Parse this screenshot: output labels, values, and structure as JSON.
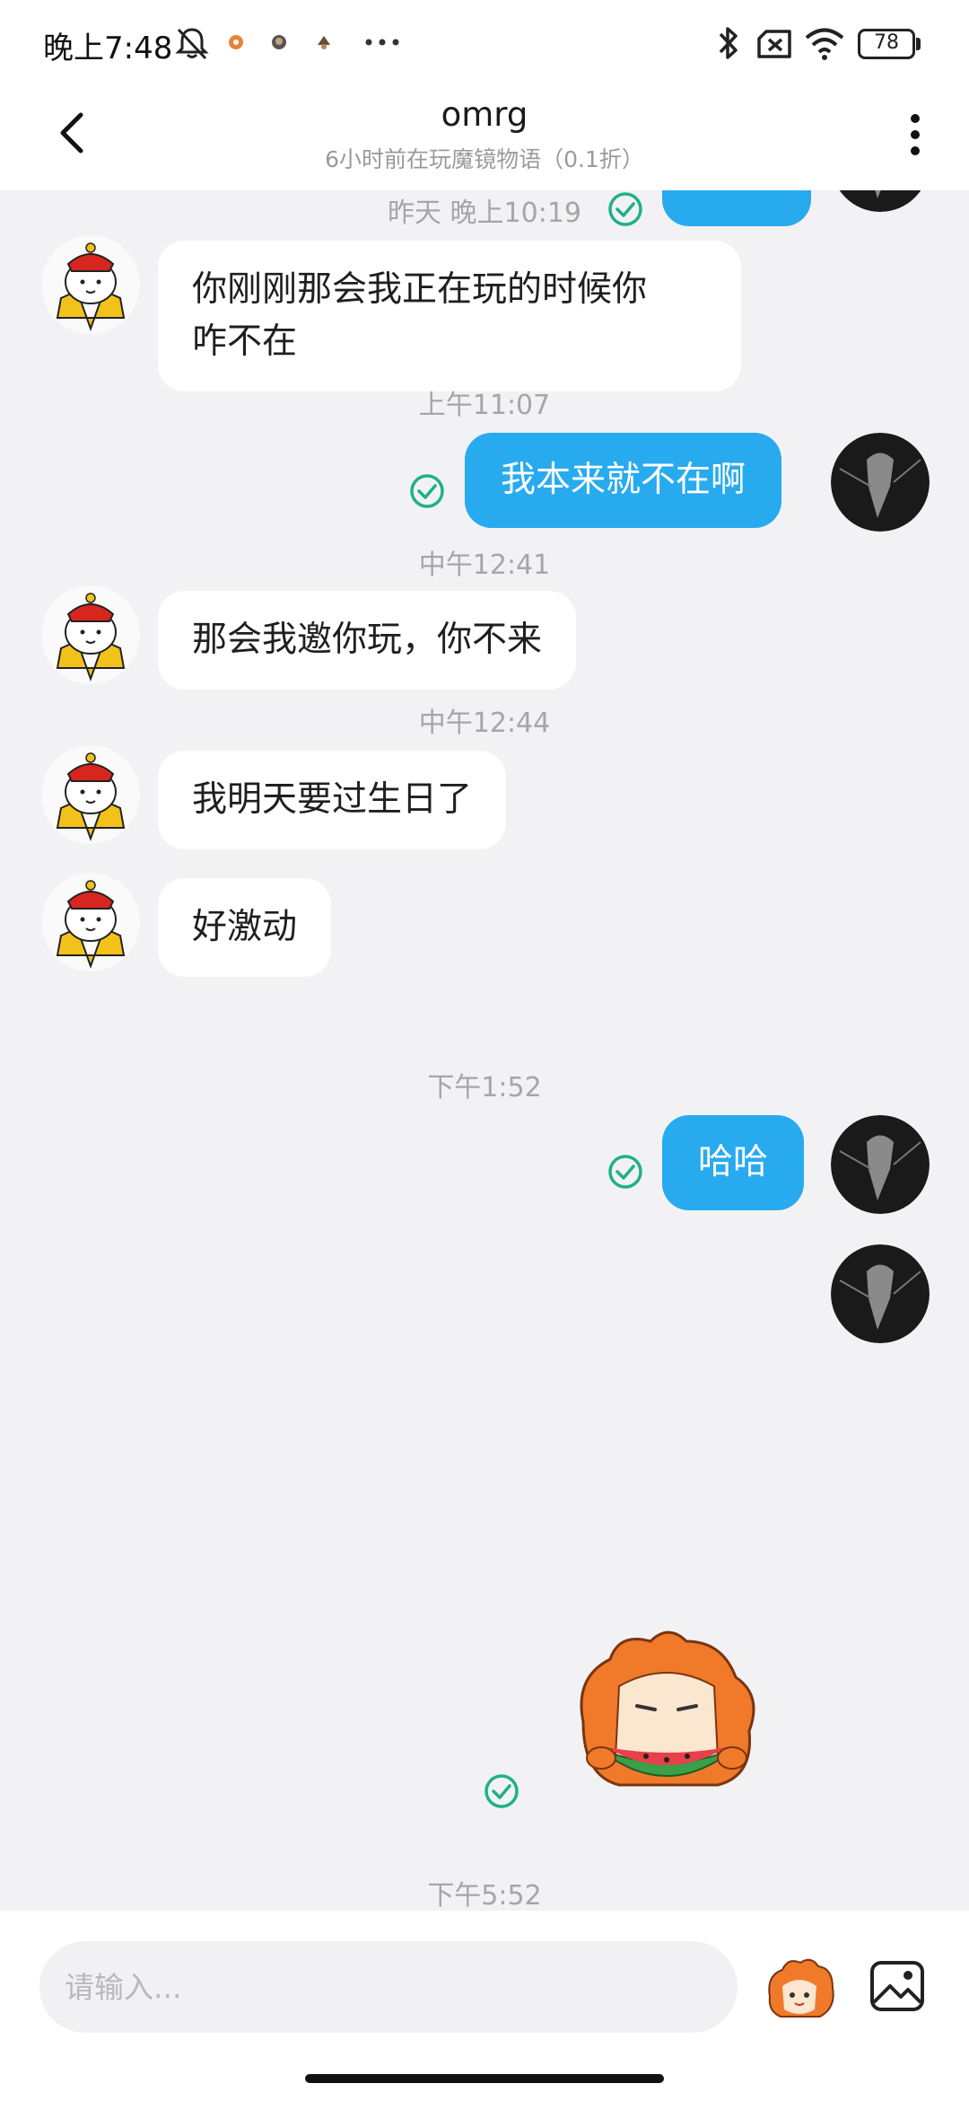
{
  "status_bar": {
    "time": "晚上7:48",
    "battery": "78",
    "icons": [
      "bell-off-icon",
      "app-notification-icon",
      "app-notification-icon",
      "app-notification-icon",
      "more-dots-icon",
      "bluetooth-icon",
      "no-sim-icon",
      "wifi-icon",
      "battery-icon"
    ]
  },
  "header": {
    "title": "omrg",
    "subtitle": "6小时前在玩魔镜物语（0.1折）",
    "back_icon": "chevron-left-icon",
    "menu_icon": "more-vertical-icon"
  },
  "messages": {
    "t1": "昨天 晚上10:19",
    "m1_line1": "你刚刚那会我正在玩的时候你",
    "m1_line2": "咋不在",
    "t2": "上午11:07",
    "m2": "我本来就不在啊",
    "t3": "中午12:41",
    "m3": "那会我邀你玩，你不来",
    "t4": "中午12:44",
    "m4": "我明天要过生日了",
    "m5": "好激动",
    "t5": "下午1:52",
    "m6": "哈哈",
    "m7_sticker": "watermelon-sticker",
    "t6": "下午5:52"
  },
  "input": {
    "placeholder": "请输入..."
  },
  "colors": {
    "outgoing_bubble": "#28aaef",
    "incoming_bubble": "#ffffff",
    "background": "#f2f2f5",
    "read_check": "#1fb08a"
  }
}
